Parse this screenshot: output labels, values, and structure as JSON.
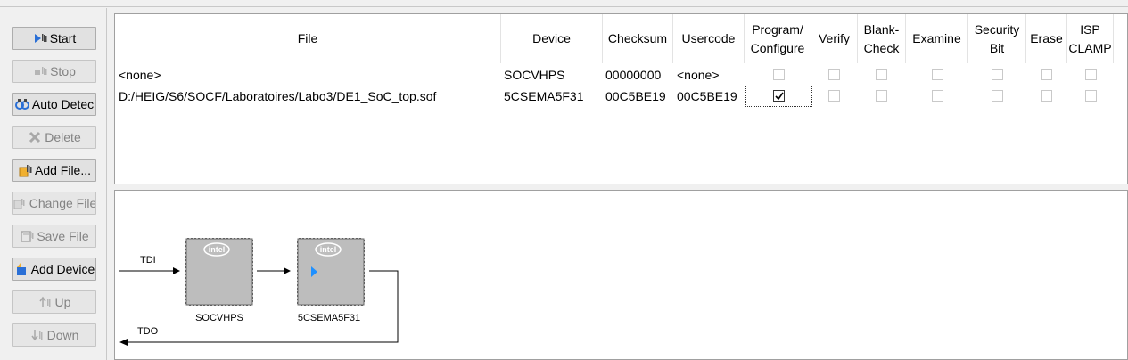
{
  "toolbar": {
    "buttons": [
      {
        "label": "Start",
        "icon": "start-icon",
        "enabled": true
      },
      {
        "label": "Stop",
        "icon": "stop-icon",
        "enabled": false
      },
      {
        "label": "Auto Detec",
        "icon": "auto-detect-icon",
        "enabled": true
      },
      {
        "label": "Delete",
        "icon": "delete-icon",
        "enabled": false
      },
      {
        "label": "Add File...",
        "icon": "add-file-icon",
        "enabled": true
      },
      {
        "label": "Change File",
        "icon": "change-file-icon",
        "enabled": false
      },
      {
        "label": "Save File",
        "icon": "save-file-icon",
        "enabled": false
      },
      {
        "label": "Add Device",
        "icon": "add-device-icon",
        "enabled": true
      },
      {
        "label": "Up",
        "icon": "up-icon",
        "enabled": false
      },
      {
        "label": "Down",
        "icon": "down-icon",
        "enabled": false
      }
    ]
  },
  "table": {
    "headers": [
      {
        "line1": "File",
        "line2": ""
      },
      {
        "line1": "Device",
        "line2": ""
      },
      {
        "line1": "Checksum",
        "line2": ""
      },
      {
        "line1": "Usercode",
        "line2": ""
      },
      {
        "line1": "Program/",
        "line2": "Configure"
      },
      {
        "line1": "Verify",
        "line2": ""
      },
      {
        "line1": "Blank-",
        "line2": "Check"
      },
      {
        "line1": "Examine",
        "line2": ""
      },
      {
        "line1": "Security",
        "line2": "Bit"
      },
      {
        "line1": "Erase",
        "line2": ""
      },
      {
        "line1": "ISP",
        "line2": "CLAMP"
      }
    ],
    "rows": [
      {
        "file": "<none>",
        "device": "SOCVHPS",
        "checksum": "00000000",
        "usercode": "<none>",
        "checks": [
          false,
          false,
          false,
          false,
          false,
          false,
          false
        ]
      },
      {
        "file": "D:/HEIG/S6/SOCF/Laboratoires/Labo3/DE1_SoC_top.sof",
        "device": "5CSEMA5F31",
        "checksum": "00C5BE19",
        "usercode": "00C5BE19",
        "checks": [
          true,
          false,
          false,
          false,
          false,
          false,
          false
        ]
      }
    ]
  },
  "chain": {
    "tdi_label": "TDI",
    "tdo_label": "TDO",
    "chip_logo": "intel",
    "devices": [
      "SOCVHPS",
      "5CSEMA5F31"
    ]
  },
  "colors": {
    "chip_body": "#c0c0c0",
    "chip_pins": "#555555",
    "selected_marker": "#1e90ff"
  }
}
